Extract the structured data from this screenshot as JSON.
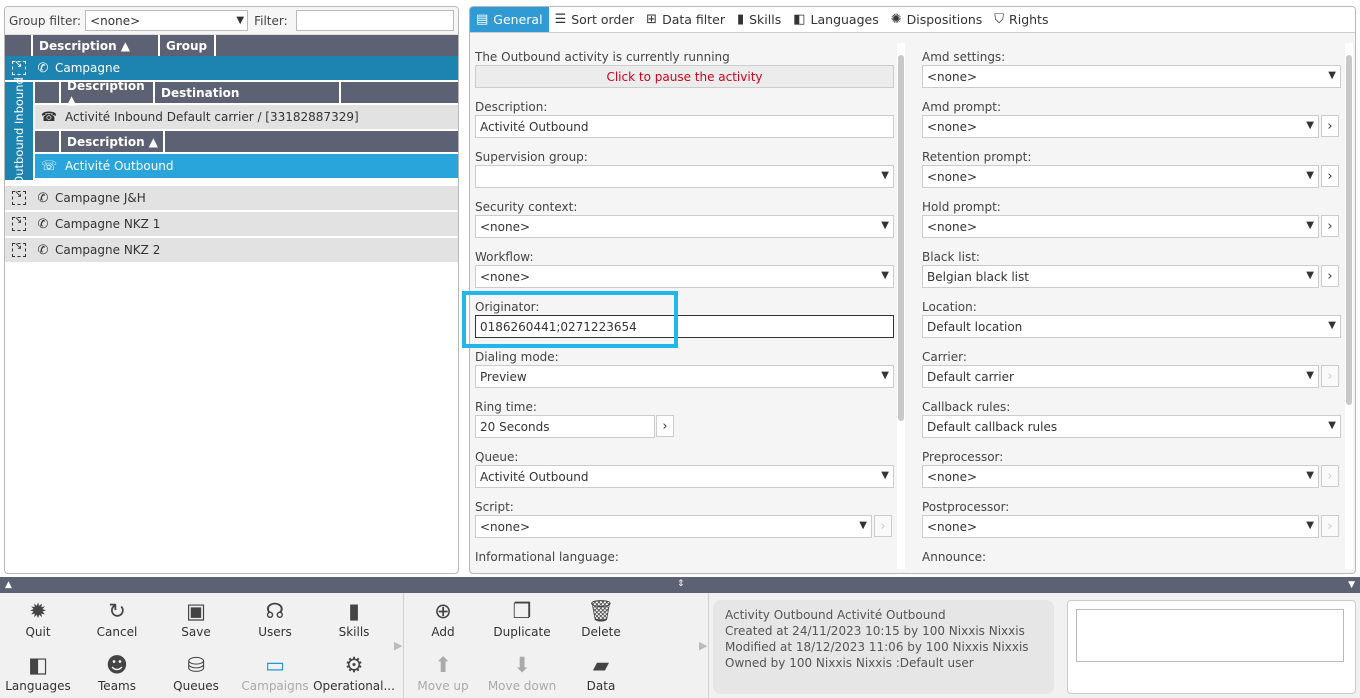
{
  "left": {
    "group_filter_label": "Group filter:",
    "group_filter_value": "<none>",
    "filter_label": "Filter:",
    "filter_value": "",
    "col_description": "Description ▲",
    "col_group": "Group",
    "campagne": "Campagne",
    "side_tab": "Outbound Inbound",
    "inbound_col_description": "Description ▲",
    "inbound_col_destination": "Destination",
    "inbound_row": "Activité Inbound  Default carrier / [33182887329]",
    "outbound_col_description": "Description ▲",
    "outbound_row": "Activité Outbound",
    "other_rows": [
      "Campagne J&H",
      "Campagne NKZ 1",
      "Campagne NKZ 2"
    ]
  },
  "tabs": [
    "General",
    "Sort order",
    "Data filter",
    "Skills",
    "Languages",
    "Dispositions",
    "Rights"
  ],
  "form_left": {
    "running_label": "The Outbound activity is currently running",
    "pause_button": "Click to pause the activity",
    "description_label": "Description:",
    "description_value": "Activité Outbound",
    "supervision_label": "Supervision group:",
    "supervision_value": "",
    "security_label": "Security context:",
    "security_value": "<none>",
    "workflow_label": "Workflow:",
    "workflow_value": "<none>",
    "originator_label": "Originator:",
    "originator_value": "0186260441;0271223654",
    "dialing_label": "Dialing mode:",
    "dialing_value": "Preview",
    "ring_label": "Ring time:",
    "ring_value": "20 Seconds",
    "queue_label": "Queue:",
    "queue_value": "Activité Outbound",
    "script_label": "Script:",
    "script_value": "<none>",
    "info_lang_label": "Informational language:"
  },
  "form_right": {
    "amd_settings_label": "Amd settings:",
    "amd_settings_value": "<none>",
    "amd_prompt_label": "Amd prompt:",
    "amd_prompt_value": "<none>",
    "retention_label": "Retention prompt:",
    "retention_value": "<none>",
    "hold_label": "Hold prompt:",
    "hold_value": "<none>",
    "blacklist_label": "Black list:",
    "blacklist_value": "Belgian black list",
    "location_label": "Location:",
    "location_value": "Default location",
    "carrier_label": "Carrier:",
    "carrier_value": "Default carrier",
    "callback_label": "Callback rules:",
    "callback_value": "Default callback rules",
    "preprocessor_label": "Preprocessor:",
    "preprocessor_value": "<none>",
    "postprocessor_label": "Postprocessor:",
    "postprocessor_value": "<none>",
    "announce_label": "Announce:"
  },
  "toolbar": {
    "quit": "Quit",
    "cancel": "Cancel",
    "save": "Save",
    "users": "Users",
    "skills": "Skills",
    "languages": "Languages",
    "teams": "Teams",
    "queues": "Queues",
    "campaigns": "Campaigns",
    "operational": "Operational...",
    "add": "Add",
    "duplicate": "Duplicate",
    "delete": "Delete",
    "move_up": "Move up",
    "move_down": "Move down",
    "data": "Data"
  },
  "info": {
    "line1": "Activity Outbound Activité Outbound",
    "line2": "Created at 24/11/2023 10:15 by 100 Nixxis Nixxis",
    "line3": "Modified at 18/12/2023 11:06 by 100 Nixxis Nixxis",
    "line4": "Owned by 100 Nixxis Nixxis :Default user"
  },
  "colors": {
    "accent": "#1d83b0",
    "selected": "#29a5dc",
    "header": "#5c6273",
    "highlight": "#23b6ea",
    "alert": "#d0021b"
  }
}
